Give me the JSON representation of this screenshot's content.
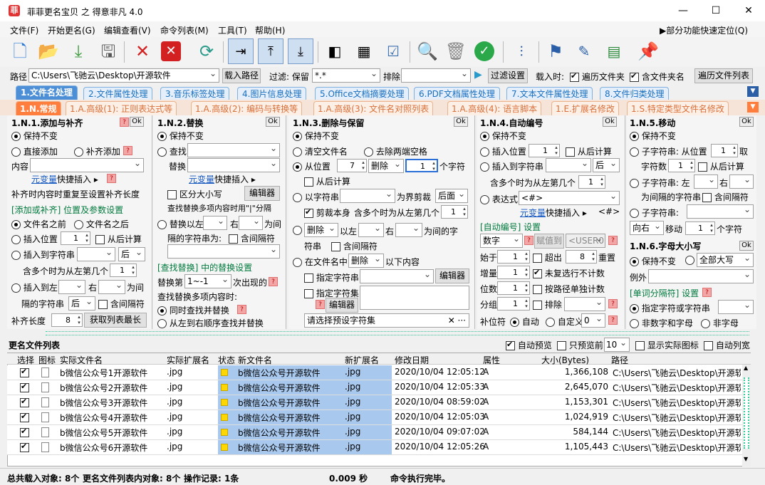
{
  "window": {
    "title": "菲菲更名宝贝 之 得意非凡 4.0",
    "minimize": "—",
    "maximize": "☐",
    "close": "✕"
  },
  "menu": [
    "文件(F)",
    "开始更名(G)",
    "编辑查看(V)",
    "命令列表(M)",
    "工具(T)",
    "帮助(H)"
  ],
  "menu_right": "▶部分功能快速定位(Q)",
  "toolbar": [
    "new-file-icon",
    "open-folder-icon",
    "import-icon",
    "save-icon",
    "delete-icon",
    "delete-all-icon",
    "refresh-icon",
    "arrow-right-icon",
    "arrow-up-icon",
    "arrow-down-icon",
    "col-left-icon",
    "col-grid-icon",
    "checklist-icon",
    "search-icon",
    "recycle-icon",
    "confirm-icon",
    "settings-sliders-icon",
    "flag-icon",
    "edit-doc-icon",
    "spreadsheet-icon",
    "pin-icon"
  ],
  "pathbar": {
    "path_label": "路径",
    "path_value": "C:\\Users\\飞驰云\\Desktop\\开源软件",
    "load_path": "载入路径",
    "filter_label": "过滤: 保留",
    "filter_value": "*.*",
    "exclude_label": "排除",
    "filter_settings": "过滤设置",
    "load_time_label": "载入时:",
    "traverse_folders": "遍历文件夹",
    "include_folder_name": "含文件夹名",
    "traverse_list": "遍历文件列表"
  },
  "tabs_main": [
    "1.文件名处理",
    "2.文件属性处理",
    "3.音乐标签处理",
    "4.图片信息处理",
    "5.Office文档摘要处理",
    "6.PDF文档属性处理",
    "7.文本文件属性处理",
    "8.文件归类处理"
  ],
  "tabs_sub": [
    "1.N.常规",
    "1.A.高级(1): 正则表达式等",
    "1.A.高级(2): 编码与转换等",
    "1.A.高级(3): 文件名对照列表",
    "1.A.高级(4): 语言脚本",
    "1.E.扩展名修改",
    "1.S.特定类型文件名修改"
  ],
  "p1": {
    "title": "1.N.1.添加与补齐",
    "ok": "Ok",
    "keep": "保持不变",
    "direct_add": "直接添加",
    "pad_add": "补齐添加",
    "content_label": "内容",
    "meta_var": "元变量",
    "quick_insert": "快捷插入 ▸",
    "pad_note": "补齐时内容时重复至设置补齐长度",
    "group": "[添加或补齐] 位置及参数设置",
    "before_name": "文件名之前",
    "after_name": "文件名之后",
    "insert_pos": "插入位置",
    "insert_pos_val": "1",
    "from_end": "从后计算",
    "insert_str": "插入到字符串",
    "after": "后",
    "nth_label": "含多个时为从左第几个",
    "nth_val": "1",
    "insert_lr": "插入到左",
    "right": "右",
    "between": "为间",
    "str_between": "隔的字符串",
    "after2": "后",
    "contains_sep": "含间隔符",
    "pad_len": "补齐长度",
    "pad_len_val": "8",
    "get_max": "获取列表最长"
  },
  "p2": {
    "title": "1.N.2.替换",
    "ok": "Ok",
    "keep": "保持不变",
    "find": "查找",
    "replace": "替换",
    "meta_var": "元变量",
    "quick_insert": "快捷插入 ▸",
    "case": "区分大小写",
    "editor": "编辑器",
    "note": "查找替换多项内容时用\"|\"分隔",
    "replace_lr": "替换以左",
    "right": "右",
    "between": "为间",
    "str_between": "隔的字符串为:",
    "contains_sep": "含间隔符",
    "group": "[查找替换] 中的替换设置",
    "replace_nth": "替换第",
    "nth_val": "1~-1",
    "nth_suffix": "次出现的",
    "multi_label": "查找替换多项内容时:",
    "sim": "同时查找并替换",
    "seq": "从左到右顺序查找并替换"
  },
  "p3": {
    "title": "1.N.3.删除与保留",
    "ok": "Ok",
    "keep": "保持不变",
    "clear_name": "清空文件名",
    "trim": "去除两端空格",
    "from_pos": "从位置",
    "from_pos_val": "7",
    "delete": "删除",
    "count_val": "1",
    "chars": "个字符",
    "from_end": "从后计算",
    "by_str": "以字符串",
    "as_boundary": "为界剪裁",
    "after": "后面",
    "cut_self": "剪裁本身",
    "nth_label": "含多个时为从左第几个",
    "nth_val": "1",
    "delete2": "删除",
    "left": "以左",
    "right": "右",
    "between": "为间的字",
    "str_label": "符串",
    "contains_sep": "含间隔符",
    "in_name": "在文件名中",
    "delete3": "删除",
    "below": "以下内容",
    "specify_str": "指定字符串",
    "editor": "编辑器",
    "specify_set": "指定字符集",
    "editor2": "编辑器",
    "preset": "请选择预设字符集"
  },
  "p4": {
    "title": "1.N.4.自动编号",
    "ok": "Ok",
    "keep": "保持不变",
    "insert_pos": "插入位置",
    "insert_pos_val": "1",
    "from_end": "从后计算",
    "insert_str": "插入到字符串",
    "after": "后",
    "nth_label": "含多个时为从左第几个",
    "nth_val": "1",
    "expr": "表达式",
    "expr_val": "<#>",
    "meta_var": "元变量",
    "quick_insert": "快捷插入 ▸",
    "token": "<#>",
    "group": "[自动编号] 设置",
    "type": "数字",
    "assign": "赋值到",
    "user_var": "<USER0>",
    "start": "始于",
    "start_val": "1",
    "exceed": "超出",
    "exceed_val": "8",
    "reset": "重置",
    "step": "增量",
    "step_val": "1",
    "skip_unselected": "未复选行不计数",
    "digits": "位数",
    "digits_val": "1",
    "by_path": "按路径单独计数",
    "group_by": "分组",
    "group_val": "1",
    "exclude": "排除",
    "pad": "补位符",
    "auto": "自动",
    "custom": "自定义",
    "custom_val": "0"
  },
  "p5": {
    "title": "1.N.5.移动",
    "ok": "Ok",
    "keep": "保持不变",
    "sub_str": "子字符串: 从位置",
    "pos_val": "1",
    "take": "取",
    "char_count": "字符数",
    "count_val": "1",
    "from_end": "从后计算",
    "sub_str2": "子字符串: 左",
    "right": "右",
    "between": "为间隔的字符串",
    "contains_sep": "含间隔符",
    "sub_str3": "子字符串:",
    "dir": "向右",
    "move": "移动",
    "move_val": "1",
    "chars": "个字符"
  },
  "p6": {
    "title": "1.N.6.字母大小写",
    "ok": "Ok",
    "keep": "保持不变",
    "all_upper": "全部大写",
    "exception": "例外",
    "group": "[单词分隔符] 设置",
    "specify": "指定字符或字符串",
    "non_num": "非数字和字母",
    "non_char": "非字母"
  },
  "list": {
    "title": "更名文件列表",
    "auto_preview": "自动预览",
    "preview_selected": "只预览前",
    "preview_n": "10",
    "show_icons": "显示实际图标",
    "auto_cols": "自动列宽",
    "headers": [
      "选择",
      "图标",
      "实际文件名",
      "实际扩展名",
      "状态",
      "新文件名",
      "新扩展名",
      "修改日期",
      "属性",
      "大小(Bytes)",
      "路径"
    ],
    "rows": [
      {
        "name": "b微信公众号1开源软件",
        "ext": ".jpg",
        "new_name": "b微信公众号开源软件",
        "new_ext": ".jpg",
        "date": "2020/10/04 12:05:12",
        "attr": "A",
        "size": "1,366,108",
        "path": "C:\\Users\\飞驰云\\Desktop\\开源软"
      },
      {
        "name": "b微信公众号2开源软件",
        "ext": ".jpg",
        "new_name": "b微信公众号开源软件",
        "new_ext": ".jpg",
        "date": "2020/10/04 12:05:33",
        "attr": "A",
        "size": "2,645,070",
        "path": "C:\\Users\\飞驰云\\Desktop\\开源软"
      },
      {
        "name": "b微信公众号3开源软件",
        "ext": ".jpg",
        "new_name": "b微信公众号开源软件",
        "new_ext": ".jpg",
        "date": "2020/10/04 08:59:02",
        "attr": "A",
        "size": "1,153,301",
        "path": "C:\\Users\\飞驰云\\Desktop\\开源软"
      },
      {
        "name": "b微信公众号4开源软件",
        "ext": ".jpg",
        "new_name": "b微信公众号开源软件",
        "new_ext": ".jpg",
        "date": "2020/10/04 12:05:03",
        "attr": "A",
        "size": "1,024,919",
        "path": "C:\\Users\\飞驰云\\Desktop\\开源软"
      },
      {
        "name": "b微信公众号5开源软件",
        "ext": ".jpg",
        "new_name": "b微信公众号开源软件",
        "new_ext": ".jpg",
        "date": "2020/10/04 09:07:02",
        "attr": "A",
        "size": "584,144",
        "path": "C:\\Users\\飞驰云\\Desktop\\开源软"
      },
      {
        "name": "b微信公众号6开源软件",
        "ext": ".jpg",
        "new_name": "b微信公众号开源软件",
        "new_ext": ".jpg",
        "date": "2020/10/04 12:05:26",
        "attr": "A",
        "size": "1,105,443",
        "path": "C:\\Users\\飞驰云\\Desktop\\开源软"
      }
    ]
  },
  "status": {
    "total": "总共载入对象: 8个",
    "list_count": "更名文件列表内对象: 8个",
    "ops": "操作记录: 1条",
    "time": "0.009 秒",
    "msg": "命令执行完毕。"
  }
}
